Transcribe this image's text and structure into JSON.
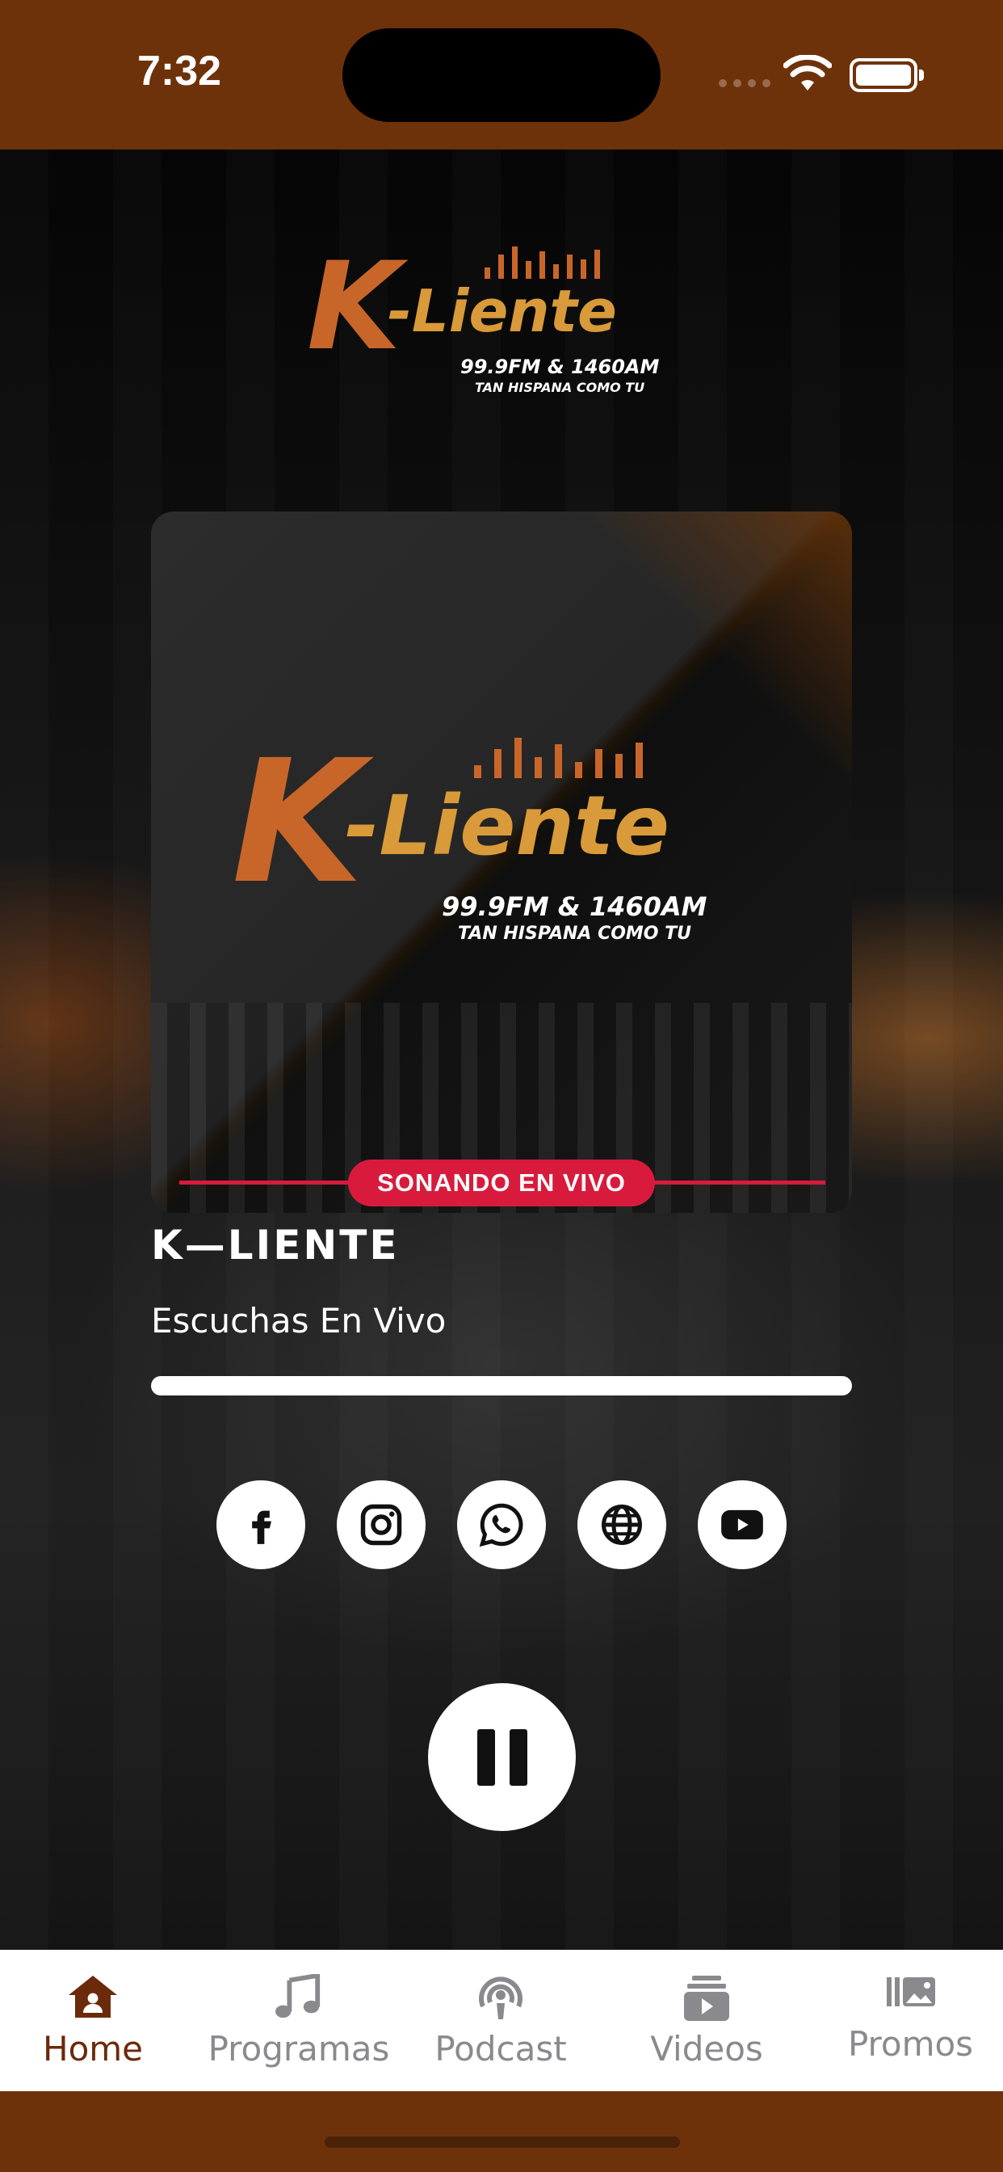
{
  "status_bar": {
    "time": "7:32"
  },
  "logo": {
    "brand_k": "K",
    "brand_rest": "-Liente",
    "frequencies": "99.9FM & 1460AM",
    "tagline": "TAN HISPANA COMO TU"
  },
  "live_badge": "SONANDO EN VIVO",
  "station": {
    "name": "K—LIENTE",
    "subtitle": "Escuchas En Vivo",
    "progress": 1.0
  },
  "socials": [
    {
      "icon": "facebook-icon"
    },
    {
      "icon": "instagram-icon"
    },
    {
      "icon": "whatsapp-icon"
    },
    {
      "icon": "globe-icon"
    },
    {
      "icon": "youtube-icon"
    }
  ],
  "player": {
    "state_icon": "pause-icon"
  },
  "tabs": [
    {
      "label": "Home",
      "icon": "home-icon",
      "active": true
    },
    {
      "label": "Programas",
      "icon": "music-note-icon",
      "active": false
    },
    {
      "label": "Podcast",
      "icon": "podcast-icon",
      "active": false
    },
    {
      "label": "Videos",
      "icon": "video-library-icon",
      "active": false
    },
    {
      "label": "Promos",
      "icon": "photo-library-icon",
      "active": false
    }
  ],
  "colors": {
    "brand_brown": "#6e320a",
    "live_red": "#d81b3c",
    "tab_active": "#6b2a09",
    "tab_inactive": "#8a8a8e"
  }
}
